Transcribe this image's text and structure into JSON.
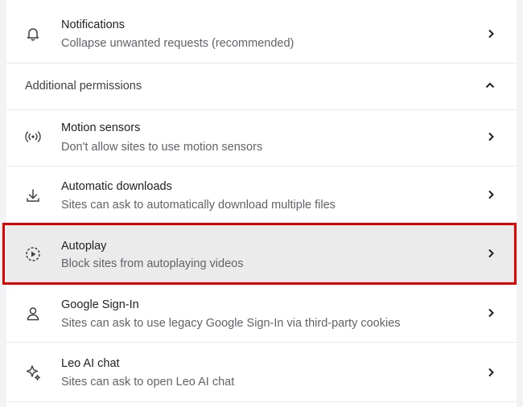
{
  "rows_top": [
    {
      "id": "notifications",
      "title": "Notifications",
      "description": "Collapse unwanted requests (recommended)",
      "icon": "bell-icon"
    }
  ],
  "section": {
    "label": "Additional permissions",
    "icon": "chevron-up-icon"
  },
  "rows": [
    {
      "id": "motion-sensors",
      "title": "Motion sensors",
      "description": "Don't allow sites to use motion sensors",
      "icon": "motion-sensor-icon"
    },
    {
      "id": "automatic-downloads",
      "title": "Automatic downloads",
      "description": "Sites can ask to automatically download multiple files",
      "icon": "download-icon"
    },
    {
      "id": "autoplay",
      "title": "Autoplay",
      "description": "Block sites from autoplaying videos",
      "icon": "autoplay-icon",
      "highlighted": true
    },
    {
      "id": "google-sign-in",
      "title": "Google Sign-In",
      "description": "Sites can ask to use legacy Google Sign-In via third-party cookies",
      "icon": "person-icon"
    },
    {
      "id": "leo-ai-chat",
      "title": "Leo AI chat",
      "description": "Sites can ask to open Leo AI chat",
      "icon": "sparkle-icon"
    }
  ],
  "colors": {
    "highlight_border": "#e00000",
    "highlight_bg": "#ebebeb"
  }
}
